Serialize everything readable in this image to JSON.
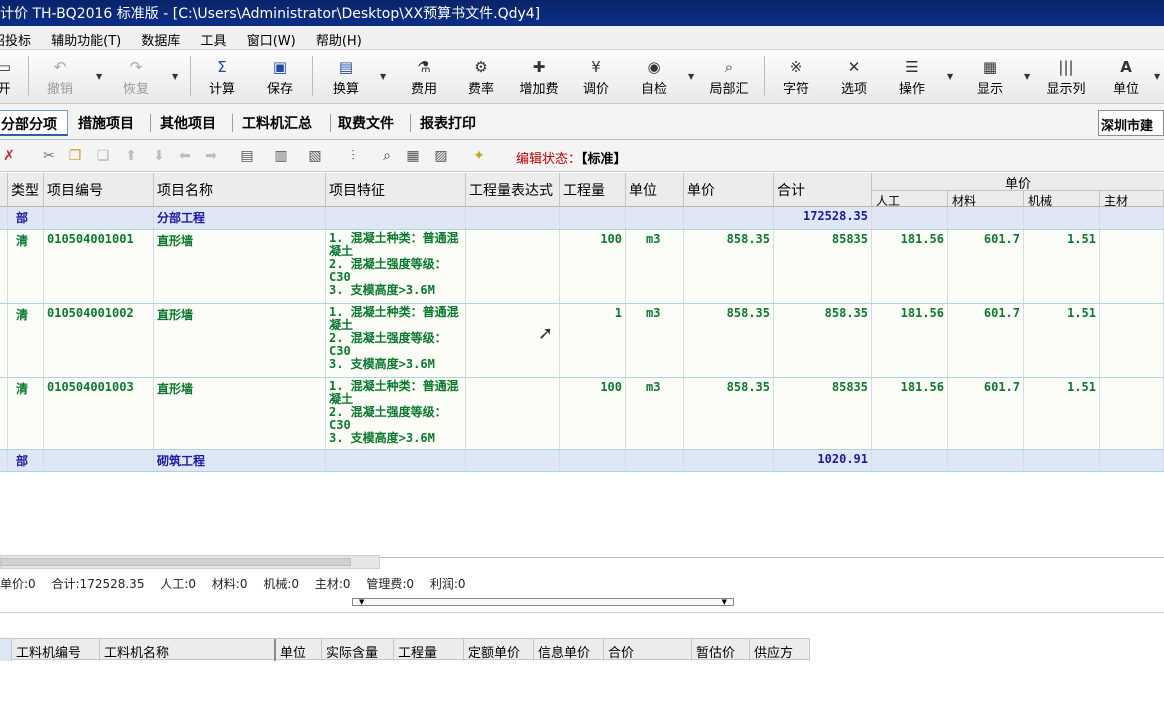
{
  "window": {
    "title": "计价 TH-BQ2016 标准版 - [C:\\Users\\Administrator\\Desktop\\XX预算书文件.Qdy4]"
  },
  "menu": [
    "招投标",
    "辅助功能(T)",
    "数据库",
    "工具",
    "窗口(W)",
    "帮助(H)"
  ],
  "toolbar": {
    "open": "开",
    "undo": "撤销",
    "redo": "恢复",
    "calc": "计算",
    "save": "保存",
    "convert": "换算",
    "fee": "费用",
    "fee_rate": "费率",
    "add_fee": "增加费",
    "adjust_price": "调价",
    "self_check": "自检",
    "local_summary": "局部汇",
    "font": "字符",
    "options": "选项",
    "operate": "操作",
    "display": "显示",
    "display_cols": "显示列",
    "unit": "单位"
  },
  "tabs": [
    "分部分项",
    "措施项目",
    "其他项目",
    "工料机汇总",
    "取费文件",
    "报表打印"
  ],
  "region": "深圳市建",
  "edit_state": {
    "label": "编辑状态：",
    "value": "【标准】"
  },
  "grid": {
    "headers": {
      "type": "类型",
      "code": "项目编号",
      "name": "项目名称",
      "feature": "项目特征",
      "expr": "工程量表达式",
      "qty": "工程量",
      "unit": "单位",
      "price": "单价",
      "total": "合计",
      "unit_price_group": "单价",
      "labor": "人工",
      "material": "材料",
      "machine": "机械",
      "main_material": "主材"
    },
    "rows": [
      {
        "type": "部",
        "code": "",
        "name": "分部工程",
        "feature": "",
        "qty": "",
        "unit": "",
        "price": "",
        "total": "172528.35",
        "labor": "",
        "material": "",
        "machine": ""
      },
      {
        "type": "清",
        "code": "010504001001",
        "name": "直形墙",
        "feature": "1. 混凝土种类：普通混凝土\n2. 混凝土强度等级：C30\n3. 支模高度>3.6M",
        "qty": "100",
        "unit": "m3",
        "price": "858.35",
        "total": "85835",
        "labor": "181.56",
        "material": "601.7",
        "machine": "1.51"
      },
      {
        "type": "清",
        "code": "010504001002",
        "name": "直形墙",
        "feature": "1. 混凝土种类：普通混凝土\n2. 混凝土强度等级：C30\n3. 支模高度>3.6M",
        "qty": "1",
        "unit": "m3",
        "price": "858.35",
        "total": "858.35",
        "labor": "181.56",
        "material": "601.7",
        "machine": "1.51"
      },
      {
        "type": "清",
        "code": "010504001003",
        "name": "直形墙",
        "feature": "1. 混凝土种类：普通混凝土\n2. 混凝土强度等级：C30\n3. 支模高度>3.6M",
        "qty": "100",
        "unit": "m3",
        "price": "858.35",
        "total": "85835",
        "labor": "181.56",
        "material": "601.7",
        "machine": "1.51"
      },
      {
        "type": "部",
        "code": "",
        "name": "砌筑工程",
        "feature": "",
        "qty": "",
        "unit": "",
        "price": "",
        "total": "1020.91",
        "labor": "",
        "material": "",
        "machine": ""
      }
    ]
  },
  "summary": {
    "unit_price": "单价:0",
    "total": "合计:172528.35",
    "labor": "人工:0",
    "material": "材料:0",
    "machine": "机械:0",
    "main_material": "主材:0",
    "management": "管理费:0",
    "profit": "利润:0"
  },
  "lower_grid": {
    "headers": [
      "工料机编号",
      "工料机名称",
      "单位",
      "实际含量",
      "工程量",
      "定额单价",
      "信息单价",
      "合价",
      "暂估价",
      "供应方"
    ]
  }
}
